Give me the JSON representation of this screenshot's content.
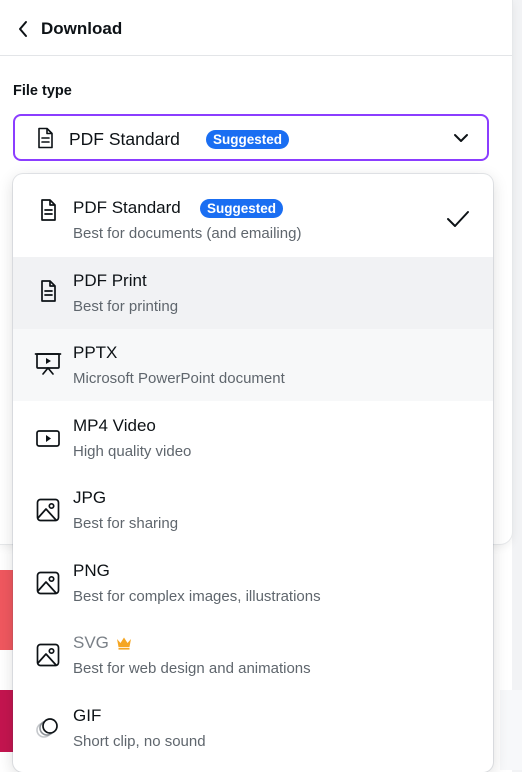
{
  "header": {
    "title": "Download"
  },
  "file_type": {
    "label": "File type",
    "selected": "PDF Standard",
    "selected_badge": "Suggested"
  },
  "options": [
    {
      "name": "PDF Standard",
      "desc": "Best for documents (and emailing)",
      "badge": "Suggested",
      "icon": "document-icon",
      "checked": true
    },
    {
      "name": "PDF Print",
      "desc": "Best for printing",
      "icon": "document-icon"
    },
    {
      "name": "PPTX",
      "desc": "Microsoft PowerPoint document",
      "icon": "presentation-icon"
    },
    {
      "name": "MP4 Video",
      "desc": "High quality video",
      "icon": "video-icon"
    },
    {
      "name": "JPG",
      "desc": "Best for sharing",
      "icon": "image-icon"
    },
    {
      "name": "PNG",
      "desc": "Best for complex images, illustrations",
      "icon": "image-icon"
    },
    {
      "name": "SVG",
      "desc": "Best for web design and animations",
      "icon": "image-icon",
      "premium": true
    },
    {
      "name": "GIF",
      "desc": "Short clip, no sound",
      "icon": "gif-icon"
    }
  ],
  "colors": {
    "accent": "#8b3dff",
    "badge": "#1a6ef2",
    "crown": "#f5a623"
  }
}
